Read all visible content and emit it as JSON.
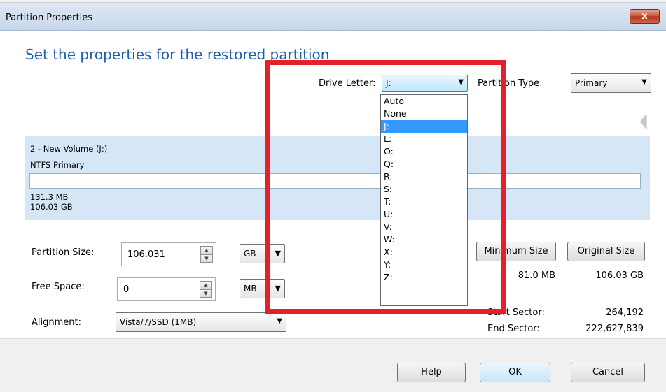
{
  "window": {
    "title": "Partition Properties",
    "close_glyph": "x"
  },
  "heading": "Set the properties for the restored partition",
  "drive_letter": {
    "label": "Drive Letter:",
    "value": "J:",
    "options": [
      "Auto",
      "None",
      "J:",
      "L:",
      "O:",
      "Q:",
      "R:",
      "S:",
      "T:",
      "U:",
      "V:",
      "W:",
      "X:",
      "Y:",
      "Z:"
    ],
    "selected_index": 2
  },
  "partition_type": {
    "label": "Partition Type:",
    "value": "Primary"
  },
  "partition": {
    "name": "2 - New Volume (J:)",
    "fs": "NTFS Primary",
    "used": "131.3 MB",
    "total": "106.03 GB"
  },
  "size": {
    "label": "Partition Size:",
    "value": "106.031",
    "unit": "GB"
  },
  "free": {
    "label": "Free Space:",
    "value": "0",
    "unit": "MB"
  },
  "alignment": {
    "label": "Alignment:",
    "value": "Vista/7/SSD (1MB)"
  },
  "size_buttons": {
    "minimum": "Minimum Size",
    "original": "Original Size",
    "minimum_value": "81.0 MB",
    "original_value": "106.03 GB"
  },
  "sectors": {
    "start_label": "Start Sector:",
    "start_value": "264,192",
    "end_label": "End Sector:",
    "end_value": "222,627,839"
  },
  "footer": {
    "help": "Help",
    "ok": "OK",
    "cancel": "Cancel"
  },
  "colors": {
    "heading": "#1f5ea8",
    "band": "#d5e7f7",
    "selection": "#3399ff",
    "highlight": "#e4212a"
  }
}
